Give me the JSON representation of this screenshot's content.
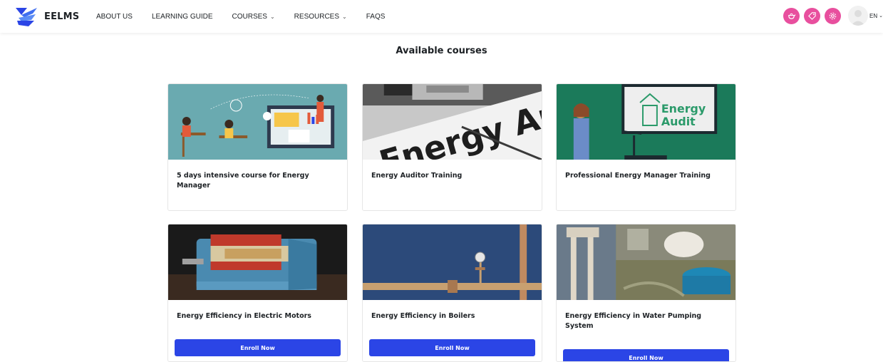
{
  "brand": {
    "name": "EELMS",
    "accent": "#2b45e6"
  },
  "nav": {
    "links": [
      {
        "label": "ABOUT US",
        "dropdown": false
      },
      {
        "label": "LEARNING GUIDE",
        "dropdown": false
      },
      {
        "label": "COURSES",
        "dropdown": true
      },
      {
        "label": "RESOURCES",
        "dropdown": true
      },
      {
        "label": "FAQS",
        "dropdown": false
      }
    ],
    "right_icons": [
      "tea-kettle-icon",
      "tags-icon",
      "gear-icon"
    ],
    "icon_color": "#e84f9e",
    "language": "EN"
  },
  "page": {
    "title": "Available courses"
  },
  "courses": [
    {
      "title": "5 days intensive course for Energy Manager",
      "image": "elearning-illustration",
      "enroll": null
    },
    {
      "title": "Energy Auditor Training",
      "image": "energy-audit-clipboard",
      "enroll": null
    },
    {
      "title": "Professional Energy Manager Training",
      "image": "energy-audit-presentation",
      "enroll": null
    },
    {
      "title": "Energy Efficiency in Electric Motors",
      "image": "electric-motor-cutaway",
      "enroll": "Enroll Now"
    },
    {
      "title": "Energy Efficiency in Boilers",
      "image": "boiler-pipes-gauge",
      "enroll": "Enroll Now"
    },
    {
      "title": "Energy Efficiency in Water Pumping System",
      "image": "water-tanks-collage",
      "enroll": "Enroll Now"
    }
  ]
}
